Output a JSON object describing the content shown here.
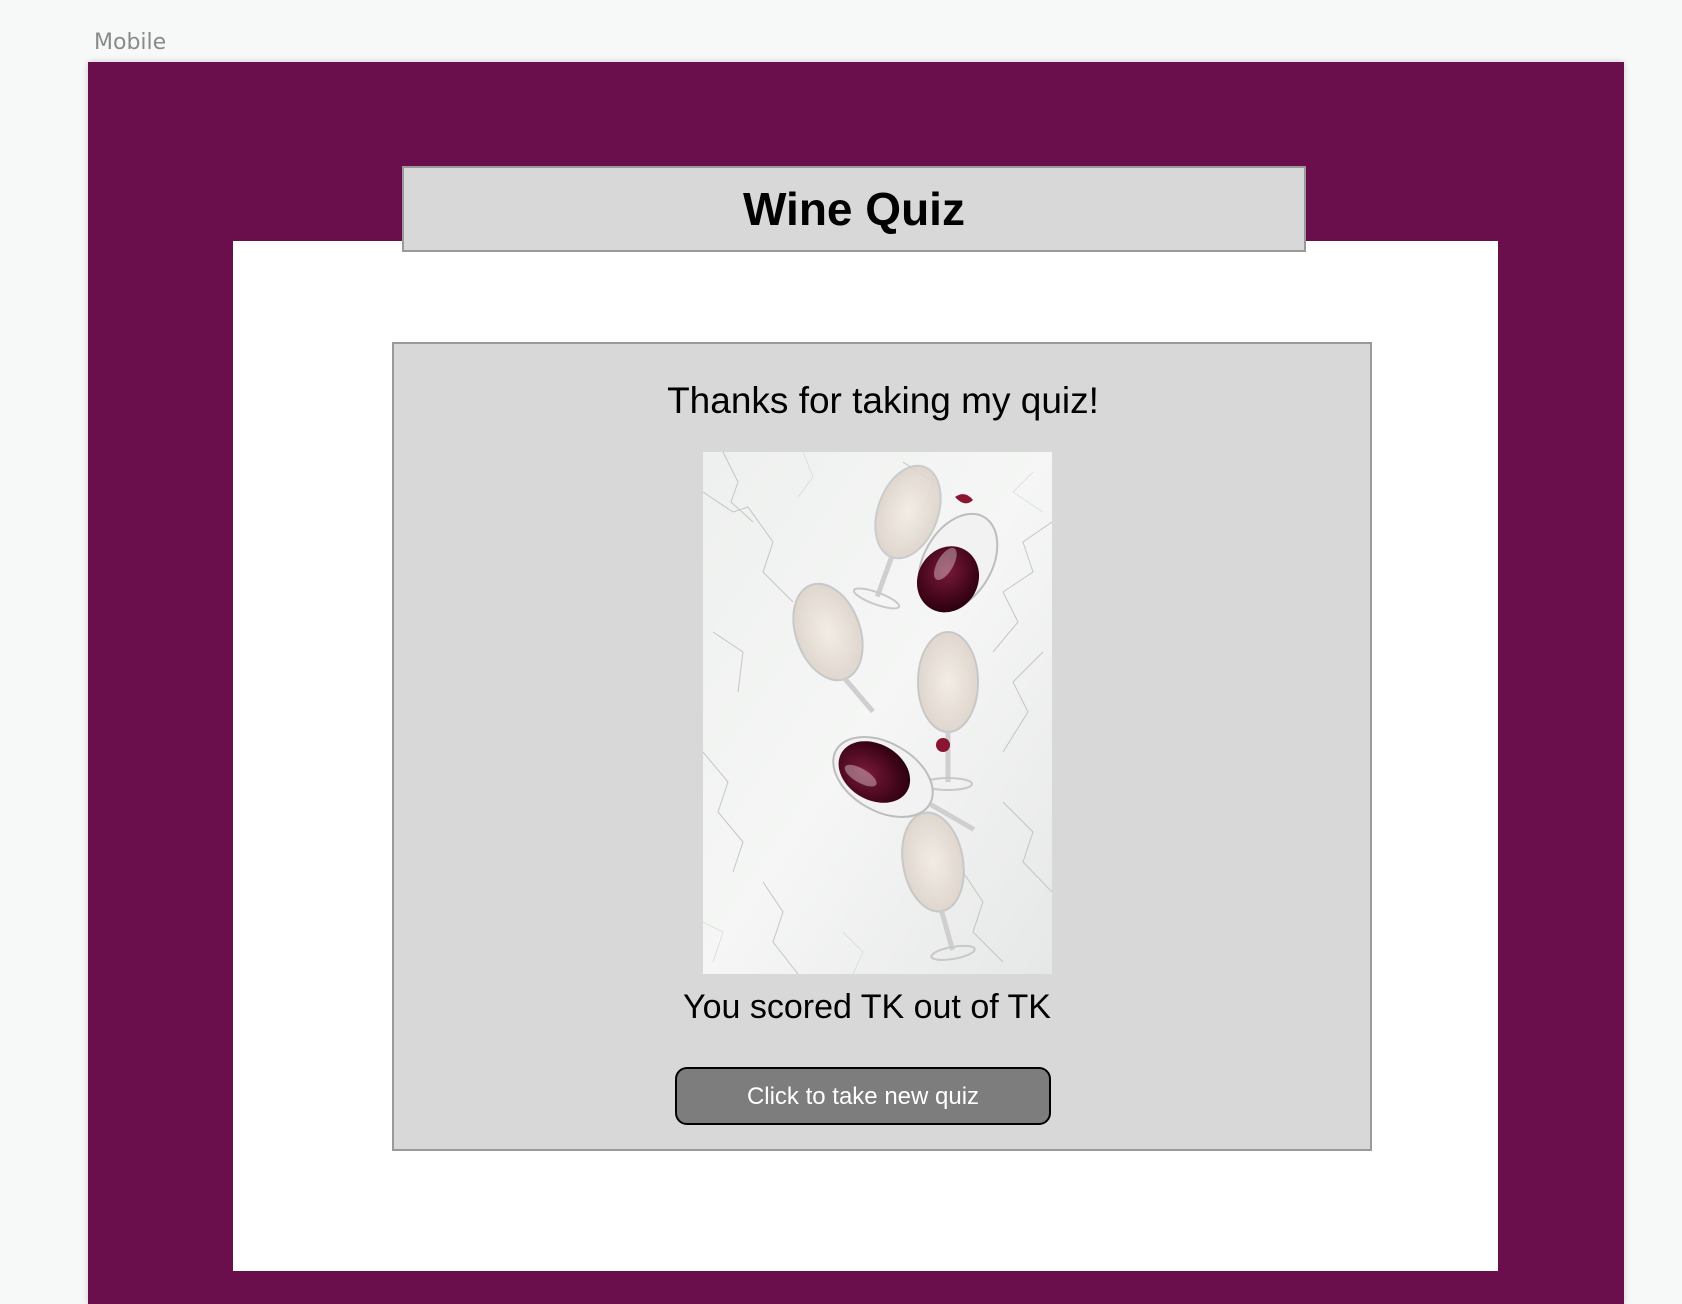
{
  "artboard": {
    "label": "Mobile",
    "background_color": "#6b0f4c"
  },
  "header": {
    "title": "Wine Quiz"
  },
  "results": {
    "thanks_text": "Thanks for taking my quiz!",
    "image_icon": "wine-glasses-on-marble-photo",
    "score_text": "You scored TK out of TK",
    "new_quiz_label": "Click to take new quiz"
  }
}
